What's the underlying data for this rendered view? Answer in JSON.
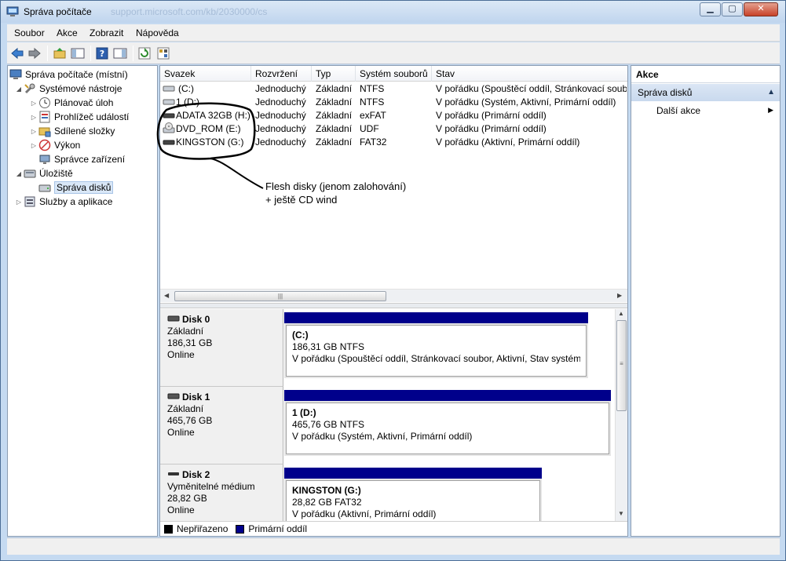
{
  "window": {
    "title": "Správa počítače",
    "title_ghost": "support.microsoft.com/kb/2030000/cs",
    "minimize": "▁",
    "maximize": "▢",
    "close": "✕"
  },
  "menu": {
    "file": "Soubor",
    "action": "Akce",
    "view": "Zobrazit",
    "help": "Nápověda"
  },
  "tree": {
    "root": "Správa počítače (místní)",
    "system_tools": "Systémové nástroje",
    "task_scheduler": "Plánovač úloh",
    "event_viewer": "Prohlížeč událostí",
    "shared_folders": "Sdílené složky",
    "performance": "Výkon",
    "device_manager": "Správce zařízení",
    "storage": "Úložiště",
    "disk_management": "Správa disků",
    "services_apps": "Služby a aplikace"
  },
  "volume_list": {
    "columns": [
      "Svazek",
      "Rozvržení",
      "Typ",
      "Systém souborů",
      "Stav"
    ],
    "rows": [
      {
        "volume": "(C:)",
        "layout": "Jednoduchý",
        "type": "Základní",
        "fs": "NTFS",
        "status": "V pořádku (Spouštěcí oddíl, Stránkovací soubor"
      },
      {
        "volume": "1 (D:)",
        "layout": "Jednoduchý",
        "type": "Základní",
        "fs": "NTFS",
        "status": "V pořádku (Systém, Aktivní, Primární oddíl)"
      },
      {
        "volume": "ADATA 32GB (H:)",
        "layout": "Jednoduchý",
        "type": "Základní",
        "fs": "exFAT",
        "status": "V pořádku (Primární oddíl)"
      },
      {
        "volume": "DVD_ROM (E:)",
        "layout": "Jednoduchý",
        "type": "Základní",
        "fs": "UDF",
        "status": "V pořádku (Primární oddíl)"
      },
      {
        "volume": "KINGSTON (G:)",
        "layout": "Jednoduchý",
        "type": "Základní",
        "fs": "FAT32",
        "status": "V pořádku (Aktivní, Primární oddíl)"
      }
    ]
  },
  "disks": [
    {
      "name": "Disk 0",
      "kind": "Základní",
      "size": "186,31 GB",
      "state": "Online",
      "part_title": "(C:)",
      "part_size": "186,31 GB NTFS",
      "part_status": "V pořádku (Spouštěcí oddíl, Stránkovací soubor, Aktivní, Stav systému,"
    },
    {
      "name": "Disk 1",
      "kind": "Základní",
      "size": "465,76 GB",
      "state": "Online",
      "part_title": "1  (D:)",
      "part_size": "465,76 GB NTFS",
      "part_status": "V pořádku (Systém, Aktivní, Primární oddíl)"
    },
    {
      "name": "Disk 2",
      "kind": "Vyměnitelné médium",
      "size": "28,82 GB",
      "state": "Online",
      "part_title": "KINGSTON  (G:)",
      "part_size": "28,82 GB FAT32",
      "part_status": "V pořádku (Aktivní, Primární oddíl)"
    }
  ],
  "legend": {
    "unallocated": "Nepřiřazeno",
    "primary": "Primární oddíl",
    "unallocated_color": "#000000",
    "primary_color": "#00008b"
  },
  "actions": {
    "header": "Akce",
    "section": "Správa disků",
    "more": "Další akce"
  },
  "annotation": {
    "line1": "Flesh disky (jenom zalohování)",
    "line2": "+ ještě CD wind"
  }
}
